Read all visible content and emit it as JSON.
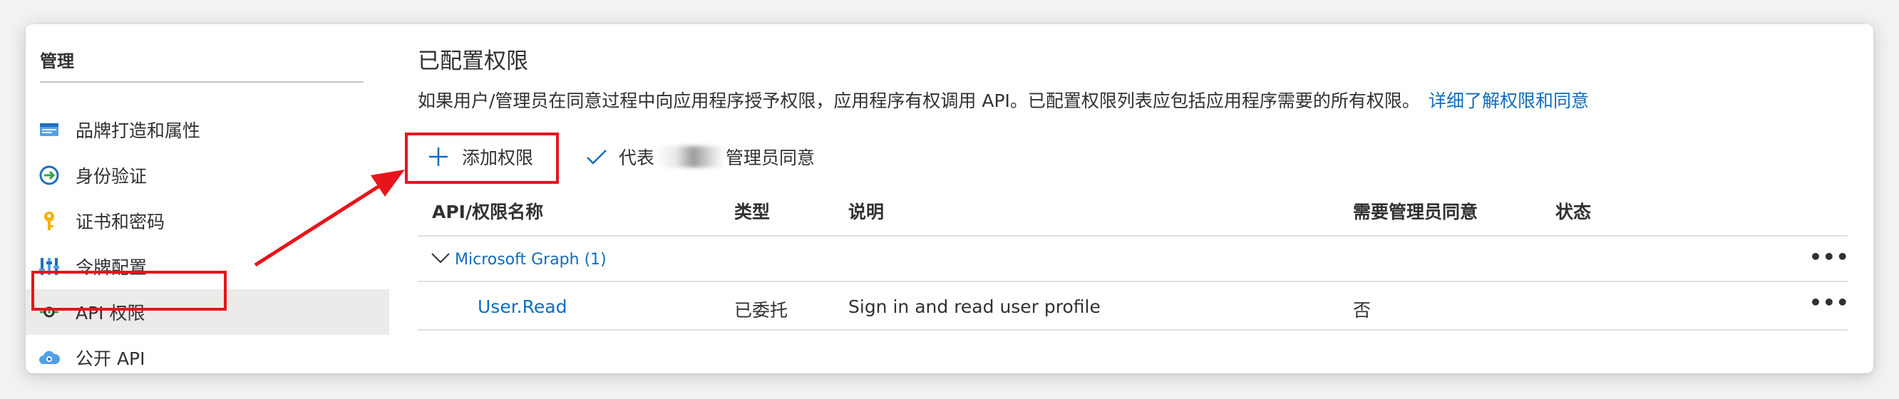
{
  "sidebar": {
    "heading": "管理",
    "items": [
      {
        "label": "品牌打造和属性",
        "icon": "branding-icon"
      },
      {
        "label": "身份验证",
        "icon": "authentication-icon"
      },
      {
        "label": "证书和密码",
        "icon": "key-icon"
      },
      {
        "label": "令牌配置",
        "icon": "token-config-icon"
      },
      {
        "label": "API 权限",
        "icon": "api-permissions-icon",
        "active": true
      },
      {
        "label": "公开 API",
        "icon": "expose-api-icon"
      }
    ]
  },
  "main": {
    "title": "已配置权限",
    "description": "如果用户/管理员在同意过程中向应用程序授予权限，应用程序有权调用 API。已配置权限列表应包括应用程序需要的所有权限。",
    "learn_more_link": "详细了解权限和同意",
    "toolbar": {
      "add_permission": "添加权限",
      "grant_consent_prefix": "代表",
      "grant_consent_suffix": "管理员同意"
    },
    "table": {
      "columns": [
        "API/权限名称",
        "类型",
        "说明",
        "需要管理员同意",
        "状态"
      ],
      "group": {
        "name": "Microsoft Graph (1)"
      },
      "rows": [
        {
          "name": "User.Read",
          "type": "已委托",
          "description": "Sign in and read user profile",
          "admin_consent": "否",
          "status": ""
        }
      ],
      "more_label": "•••"
    }
  },
  "colors": {
    "link": "#0f6cbd",
    "highlight": "#e8141c",
    "active_bg": "#edebe9"
  }
}
